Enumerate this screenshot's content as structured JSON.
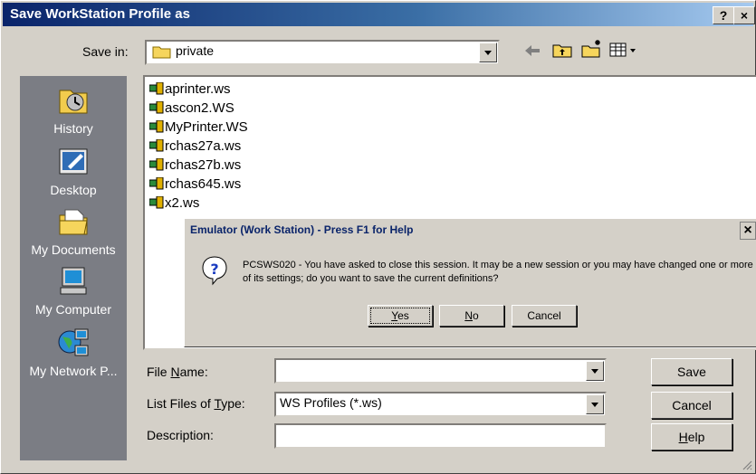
{
  "window": {
    "title": "Save WorkStation Profile as",
    "help_btn": "?",
    "close_btn": "×"
  },
  "save_in": {
    "label": "Save in:",
    "value": "private"
  },
  "toolbar": {
    "icons": [
      "back-icon",
      "up-folder-icon",
      "new-folder-icon",
      "view-menu-icon"
    ]
  },
  "places": [
    {
      "label": "History",
      "icon": "history-icon"
    },
    {
      "label": "Desktop",
      "icon": "desktop-icon"
    },
    {
      "label": "My Documents",
      "icon": "my-documents-icon"
    },
    {
      "label": "My Computer",
      "icon": "my-computer-icon"
    },
    {
      "label": "My Network P...",
      "icon": "my-network-places-icon"
    }
  ],
  "files": [
    "aprinter.ws",
    "ascon2.WS",
    "MyPrinter.WS",
    "rchas27a.ws",
    "rchas27b.ws",
    "rchas645.ws",
    "x2.ws"
  ],
  "form": {
    "file_name_label_pre": "File ",
    "file_name_label_u": "N",
    "file_name_label_post": "ame:",
    "file_name_value": "",
    "type_label_pre": "List Files of ",
    "type_label_u": "T",
    "type_label_post": "ype:",
    "type_value": "WS Profiles (*.ws)",
    "desc_label": "Description:",
    "desc_value": ""
  },
  "buttons": {
    "save": "Save",
    "cancel": "Cancel",
    "help_u": "H",
    "help_rest": "elp"
  },
  "dialog": {
    "title": "Emulator (Work Station) - Press F1 for Help",
    "close": "×",
    "message": "PCSWS020 - You have asked to close this session.  It may be a new session or you may have changed one or more of its settings; do you want to save the current definitions?",
    "yes_u": "Y",
    "yes_rest": "es",
    "no_u": "N",
    "no_rest": "o",
    "cancel": "Cancel",
    "icon": "question-icon"
  }
}
